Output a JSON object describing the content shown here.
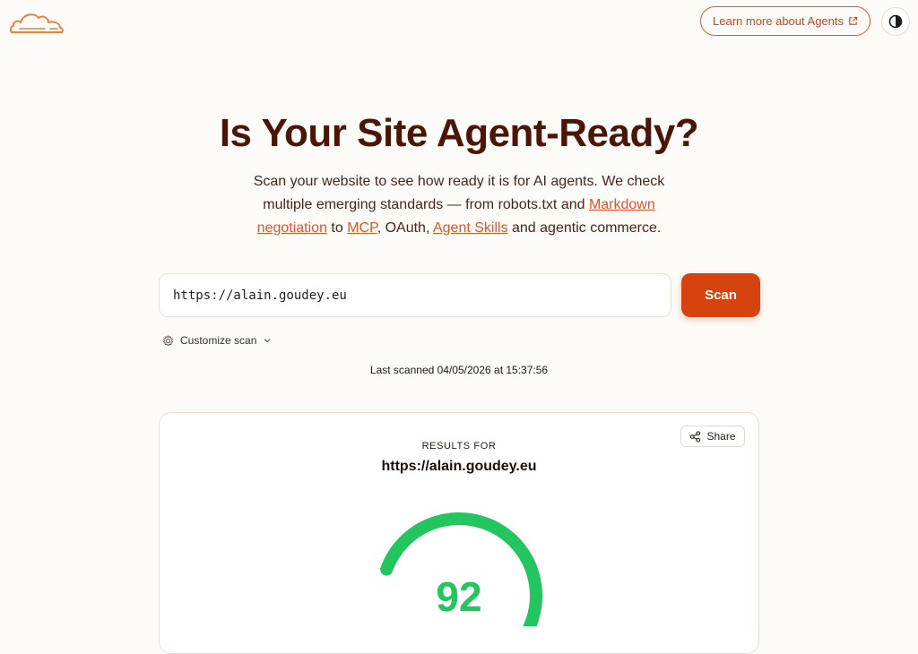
{
  "header": {
    "logo_icon": "cloud-logo-icon",
    "learn_more_label": "Learn more about Agents",
    "theme_icon": "contrast-icon"
  },
  "hero": {
    "title": "Is Your Site Agent-Ready?",
    "subtitle_1": "Scan your website to see how ready it is for AI agents. We check multiple emerging standards — from robots.txt and ",
    "link_markdown": "Markdown negotiation",
    "subtitle_2": " to ",
    "link_mcp": "MCP",
    "subtitle_3": ", OAuth, ",
    "link_skills": "Agent Skills",
    "subtitle_4": " and agentic commerce."
  },
  "scan": {
    "url_value": "https://alain.goudey.eu",
    "button_label": "Scan",
    "customize_label": "Customize scan",
    "last_scanned": "Last scanned 04/05/2026 at 15:37:56"
  },
  "results": {
    "share_label": "Share",
    "label": "RESULTS FOR",
    "url": "https://alain.goudey.eu",
    "score": 92,
    "score_max": 100,
    "score_color": "#22c55e",
    "track_color": "#e6d9cd"
  },
  "colors": {
    "accent": "#e0552a",
    "scan_button": "#d6430f",
    "title": "#4b1608",
    "background": "#fdfbf8"
  }
}
